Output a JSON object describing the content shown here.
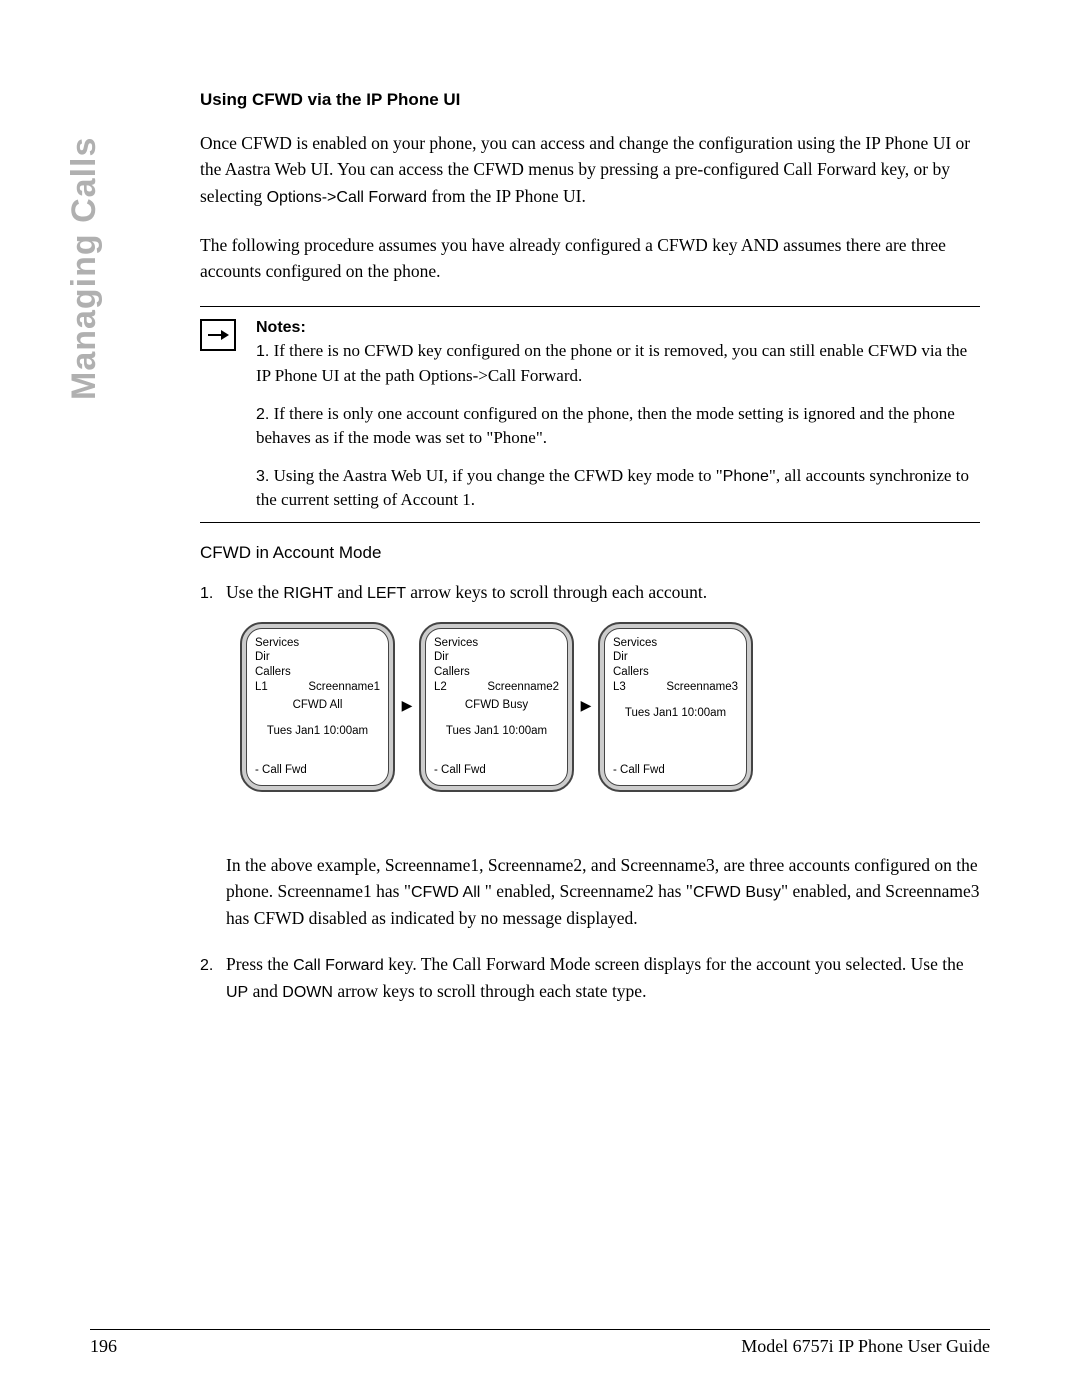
{
  "sideTab": "Managing Calls",
  "heading": "Using CFWD via the IP Phone UI",
  "para1a": "Once CFWD is enabled on your phone, you can access and change the configuration using the IP Phone UI or the Aastra Web UI. You can access the CFWD menus by pressing a pre-configured Call Forward key, or by selecting ",
  "para1b": "Options->Call Forward",
  "para1c": " from the IP Phone UI.",
  "para2": "The following procedure assumes you have already configured a CFWD key AND assumes there are three accounts configured on the phone.",
  "notesTitle": "Notes:",
  "note1num": "1.",
  "note1": "  If there is no CFWD key configured on the phone or it is removed, you can still enable CFWD via the IP Phone UI at the path Options->Call Forward.",
  "note2num": "2.",
  "note2": "  If there is only one account configured on the phone, then the mode setting is ignored and the phone behaves as if the mode was set to \"Phone\".",
  "note3num": "3.",
  "note3a": "  Using the Aastra Web UI, if you change the CFWD key mode to \"",
  "note3b": "Phone",
  "note3c": "\", all accounts synchronize to the current setting of Account 1.",
  "subHeading": "CFWD in Account Mode",
  "step1num": "1.",
  "step1a": "Use the ",
  "step1b": "RIGHT ",
  "step1c": " and ",
  "step1d": "LEFT ",
  "step1e": " arrow keys to scroll through each account.",
  "screens": [
    {
      "l1": "Services",
      "l2": "Dir",
      "l3": "Callers",
      "line": "L1",
      "name": "Screenname1",
      "status": "CFWD All",
      "time": "Tues Jan1 10:00am",
      "bottom": "- Call Fwd"
    },
    {
      "l1": "Services",
      "l2": "Dir",
      "l3": "Callers",
      "line": "L2",
      "name": "Screenname2",
      "status": "CFWD Busy",
      "time": "Tues Jan1 10:00am",
      "bottom": "- Call Fwd"
    },
    {
      "l1": "Services",
      "l2": "Dir",
      "l3": "Callers",
      "line": "L3",
      "name": "Screenname3",
      "status": "",
      "time": "Tues Jan1 10:00am",
      "bottom": "- Call Fwd"
    }
  ],
  "arrow": "▶",
  "afterA": "In the above example, Screenname1, Screenname2, and Screenname3, are three accounts configured on the phone. Screenname1 has \"",
  "afterB": "CFWD All ",
  "afterC": "\" enabled, Screenname2 has \"",
  "afterD": "CFWD Busy",
  "afterE": "\" enabled, and Screenname3 has CFWD disabled as indicated by no message displayed.",
  "step2num": "2.",
  "step2a": "Press the ",
  "step2b": "Call Forward ",
  "step2c": " key. The Call Forward Mode screen displays for the account you selected. Use the ",
  "step2d": "UP",
  "step2e": " and ",
  "step2f": "DOWN ",
  "step2g": " arrow keys to scroll through each state type.",
  "footerPage": "196",
  "footerTitle": "Model 6757i IP Phone User Guide"
}
